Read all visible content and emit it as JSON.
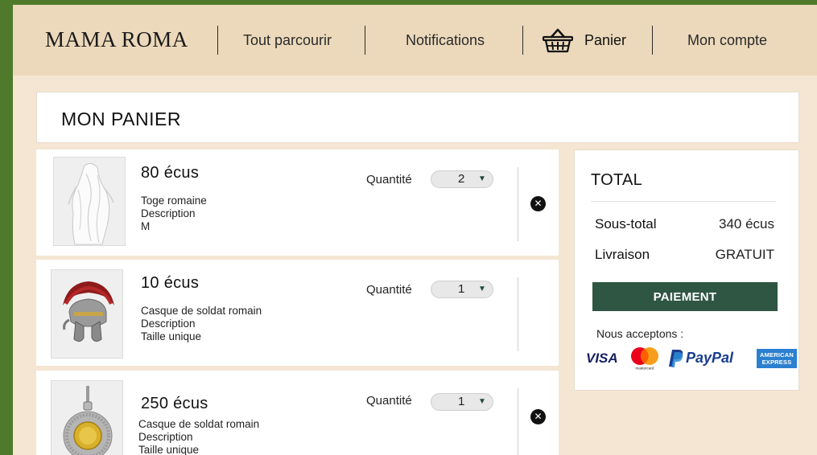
{
  "header": {
    "logo": "MAMA ROMA",
    "nav": {
      "browse": "Tout parcourir",
      "notifications": "Notifications",
      "cart": "Panier",
      "account": "Mon compte"
    }
  },
  "page_title": "MON PANIER",
  "items": [
    {
      "price": "80 écus",
      "name": "Toge romaine",
      "description": "Description",
      "size": "M",
      "qty_label": "Quantité",
      "qty": "2",
      "image": "toga"
    },
    {
      "price": "10 écus",
      "name": "Casque de soldat romain",
      "description": "Description",
      "size": "Taille unique",
      "qty_label": "Quantité",
      "qty": "1",
      "image": "helmet"
    },
    {
      "price": "250 écus",
      "name": "Casque de soldat romain",
      "description": "Description",
      "size": "Taille unique",
      "qty_label": "Quantité",
      "qty": "1",
      "image": "medallion"
    }
  ],
  "summary": {
    "title": "TOTAL",
    "subtotal_label": "Sous-total",
    "subtotal_value": "340 écus",
    "shipping_label": "Livraison",
    "shipping_value": "GRATUIT",
    "pay_button": "PAIEMENT",
    "accept_label": "Nous acceptons :",
    "cards": {
      "visa": "VISA",
      "mastercard": "mastercard",
      "paypal": "PayPal",
      "amex_line1": "AMERICAN",
      "amex_line2": "EXPRESS"
    }
  },
  "colors": {
    "outer_green": "#4f7a2b",
    "header_bg": "#ecd9bb",
    "page_bg": "#f4e6d2",
    "pay_button": "#2f5643"
  },
  "icons": [
    "basket-icon",
    "close-icon",
    "chevron-down-icon"
  ]
}
